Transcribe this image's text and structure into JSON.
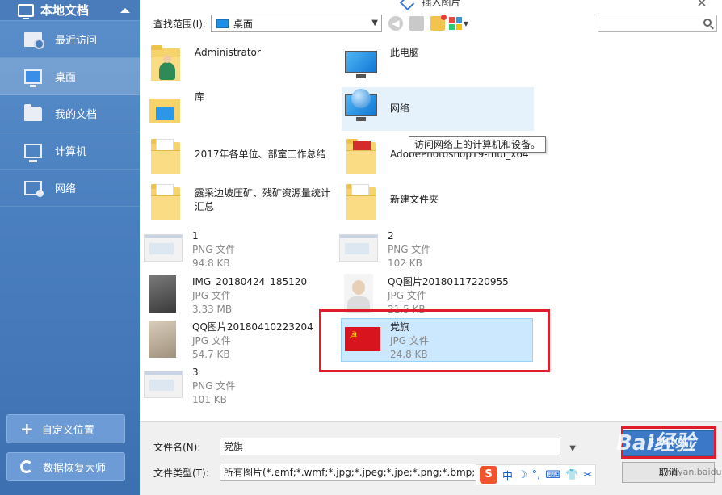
{
  "window": {
    "title": "插入图片"
  },
  "sidebar": {
    "header": "本地文档",
    "items": [
      {
        "label": "最近访问",
        "icon": "recent-icon"
      },
      {
        "label": "桌面",
        "icon": "desktop-icon",
        "active": true
      },
      {
        "label": "我的文档",
        "icon": "documents-icon"
      },
      {
        "label": "计算机",
        "icon": "computer-icon"
      },
      {
        "label": "网络",
        "icon": "network-icon"
      }
    ],
    "custom_location": "自定义位置",
    "data_recovery": "数据恢复大师"
  },
  "toolbar": {
    "lookin_label": "查找范围(I):",
    "lookin_value": "桌面",
    "search_placeholder": ""
  },
  "files": [
    {
      "name": "Administrator",
      "type": "",
      "size": "",
      "kind": "user-folder"
    },
    {
      "name": "此电脑",
      "type": "",
      "size": "",
      "kind": "computer"
    },
    {
      "name": "库",
      "type": "",
      "size": "",
      "kind": "library"
    },
    {
      "name": "网络",
      "type": "",
      "size": "",
      "kind": "network"
    },
    {
      "name": "2017年各单位、部室工作总结",
      "type": "",
      "size": "",
      "kind": "folder"
    },
    {
      "name": "AdobePhotoshop19-mul_x64",
      "type": "",
      "size": "",
      "kind": "folder-red"
    },
    {
      "name": "露采边坡压矿、残矿资源量统计汇总",
      "type": "",
      "size": "",
      "kind": "folder"
    },
    {
      "name": "新建文件夹",
      "type": "",
      "size": "",
      "kind": "folder"
    },
    {
      "name": "1",
      "type": "PNG 文件",
      "size": "94.8 KB",
      "kind": "png"
    },
    {
      "name": "2",
      "type": "PNG 文件",
      "size": "102 KB",
      "kind": "png"
    },
    {
      "name": "IMG_20180424_185120",
      "type": "JPG 文件",
      "size": "3.33 MB",
      "kind": "photo-dark"
    },
    {
      "name": "QQ图片20180117220955",
      "type": "JPG 文件",
      "size": "21.5 KB",
      "kind": "photo-face"
    },
    {
      "name": "QQ图片20180410223204",
      "type": "JPG 文件",
      "size": "54.7 KB",
      "kind": "photo-paper"
    },
    {
      "name": "党旗",
      "type": "JPG 文件",
      "size": "24.8 KB",
      "kind": "flag"
    },
    {
      "name": "3",
      "type": "PNG 文件",
      "size": "101 KB",
      "kind": "png"
    }
  ],
  "tooltip": "访问网络上的计算机和设备。",
  "bottom": {
    "filename_label": "文件名(N):",
    "filename_value": "党旗",
    "filetype_label": "文件类型(T):",
    "filetype_value": "所有图片(*.emf;*.wmf;*.jpg;*.jpeg;*.jpe;*.png;*.bmp;*.gif;*.ti",
    "open_label": "打开(O)",
    "cancel_label": "取消"
  },
  "ime": {
    "logo": "S",
    "items": [
      "中",
      "☽",
      "°,",
      "⌨",
      "👕",
      "✂"
    ]
  },
  "watermark": {
    "text": "Bai经验",
    "sub": "jingyan.baidu.com"
  },
  "colors": {
    "sidebar": "#4a7fbf",
    "accent": "#3b78c8",
    "highlight": "#e01b2a",
    "selection": "#cce8ff"
  }
}
